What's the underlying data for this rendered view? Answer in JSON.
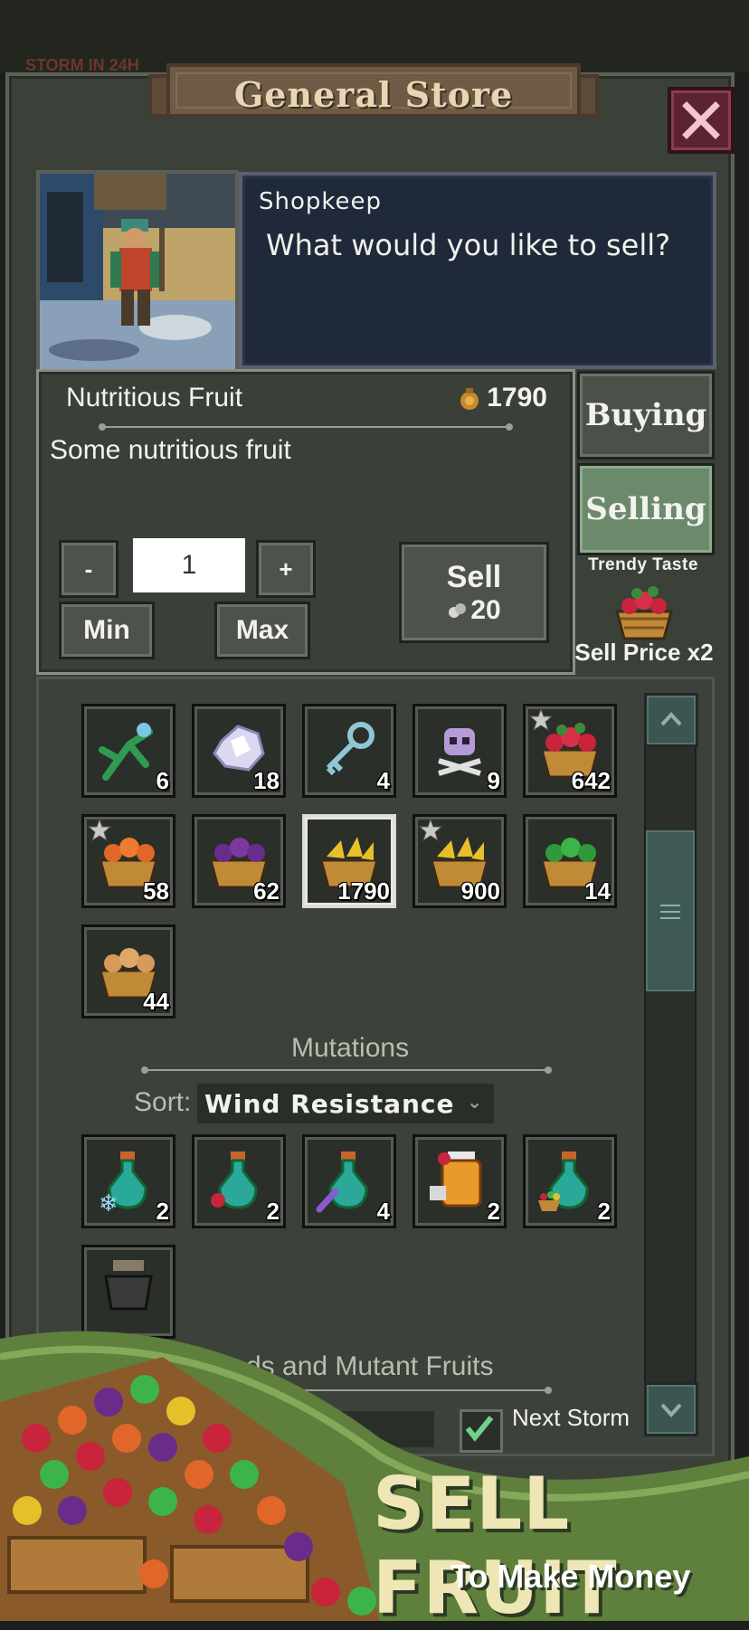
{
  "background": {
    "storm_text": "STORM IN 24H"
  },
  "store": {
    "title": "General Store",
    "close_label": "✕"
  },
  "dialog": {
    "speaker": "Shopkeep",
    "text": "What would you like to sell?"
  },
  "selected_item": {
    "name": "Nutritious Fruit",
    "price": "1790",
    "description": "Some nutritious fruit",
    "quantity": "1",
    "minus_label": "-",
    "plus_label": "+",
    "min_label": "Min",
    "max_label": "Max",
    "sell_label": "Sell",
    "sell_value": "20"
  },
  "mode_tabs": {
    "buying": "Buying",
    "selling": "Selling",
    "active": "Selling"
  },
  "trendy": {
    "title": "Trendy Taste",
    "multiplier": "Sell Price x2"
  },
  "inventory": {
    "items": [
      {
        "icon": "plant-icon",
        "count": "6"
      },
      {
        "icon": "crystal-icon",
        "count": "18"
      },
      {
        "icon": "key-icon",
        "count": "4"
      },
      {
        "icon": "skull-icon",
        "count": "9"
      },
      {
        "icon": "red-fruit-basket-icon",
        "count": "642",
        "starred": true
      },
      {
        "icon": "orange-fruit-basket-icon",
        "count": "58",
        "starred": true
      },
      {
        "icon": "purple-fruit-basket-icon",
        "count": "62"
      },
      {
        "icon": "yellow-fruit-basket-icon",
        "count": "1790",
        "selected": true
      },
      {
        "icon": "yellow-fruit-basket-icon",
        "count": "900",
        "starred": true
      },
      {
        "icon": "green-fruit-basket-icon",
        "count": "14"
      },
      {
        "icon": "tan-fruit-basket-icon",
        "count": "44"
      }
    ],
    "mutations_title": "Mutations",
    "sort_label": "Sort:",
    "sort_value": "Wind Resistance",
    "mutations": [
      {
        "icon": "frost-potion-icon",
        "count": "2"
      },
      {
        "icon": "berry-potion-icon",
        "count": "2"
      },
      {
        "icon": "feather-potion-icon",
        "count": "4"
      },
      {
        "icon": "honey-jar-icon",
        "count": "2"
      },
      {
        "icon": "fruit-potion-icon",
        "count": "2"
      },
      {
        "icon": "cauldron-icon",
        "count": ""
      }
    ],
    "seeds_title": "ds and Mutant Fruits",
    "next_storm_label": "Next Storm"
  },
  "promo": {
    "title": "SELL FRUIT",
    "subtitle": "To Make Money"
  },
  "colors": {
    "panel": "#3b4038",
    "dialog_bg": "#1f2939",
    "selling_active": "#6b8a6c",
    "close_btn": "#5b2430",
    "promo_green": "#5f7f3c"
  }
}
